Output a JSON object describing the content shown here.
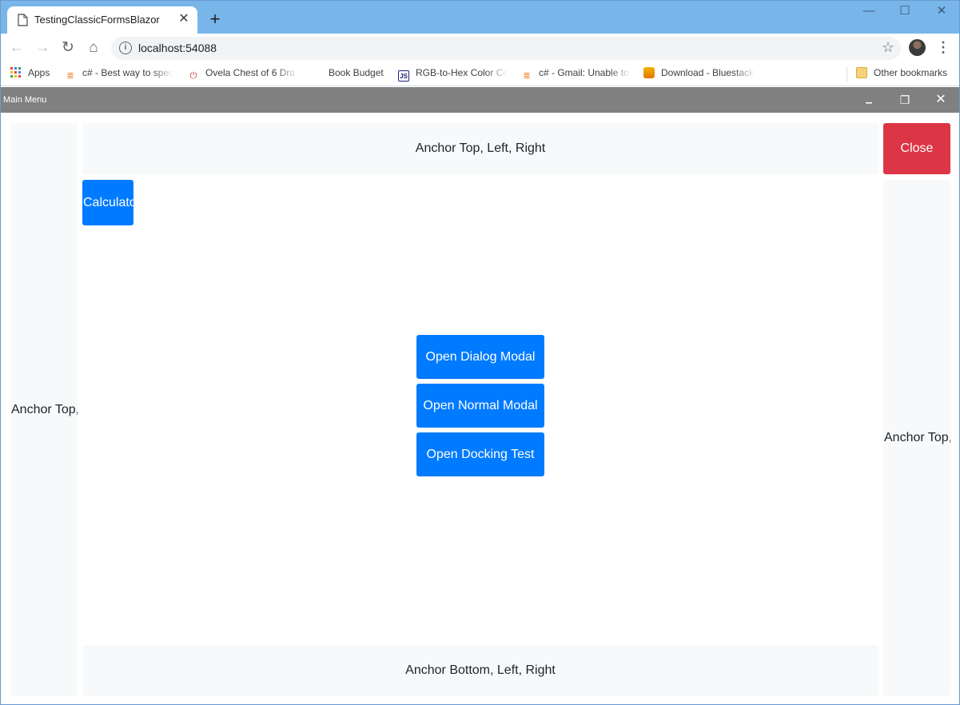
{
  "browser": {
    "tab_title": "TestingClassicFormsBlazor",
    "tab_close": "✕",
    "new_tab": "+",
    "url": "localhost:54088",
    "window_controls": {
      "minimize": "—",
      "maximize": "☐",
      "close": "✕"
    },
    "bookmarks": [
      {
        "label": "Apps",
        "icon": "apps-grid-icon"
      },
      {
        "label": "c# - Best way to spec",
        "icon": "stackoverflow-icon"
      },
      {
        "label": "Ovela Chest of 6 Dra",
        "icon": "power-icon"
      },
      {
        "label": "Book Budget",
        "icon": "blank-icon"
      },
      {
        "label": "RGB-to-Hex Color Co",
        "icon": "js-icon"
      },
      {
        "label": "c# - Gmail: Unable to",
        "icon": "stackoverflow-icon"
      },
      {
        "label": "Download - Bluestack",
        "icon": "bluestacks-icon"
      }
    ],
    "other_bookmarks": "Other bookmarks"
  },
  "app": {
    "window_title": "Main Menu",
    "controls": {
      "minimize": "▁",
      "restore": "❐",
      "close": "✕"
    },
    "panels": {
      "top": "Anchor Top, Left, Right",
      "bottom": "Anchor Bottom, Left, Right",
      "left": "Anchor Top, Left, Bottom",
      "right": "Anchor Top, Right, Bottom"
    },
    "buttons": {
      "close": "Close",
      "calculator": "Calculator",
      "open_dialog_modal": "Open Dialog Modal",
      "open_normal_modal": "Open Normal Modal",
      "open_docking_test": "Open Docking Test"
    }
  },
  "colors": {
    "primary": "#007bff",
    "danger": "#dc3545",
    "panel": "#f8f9fa",
    "titlebar": "#808080",
    "tabstrip": "#78b6ea"
  }
}
